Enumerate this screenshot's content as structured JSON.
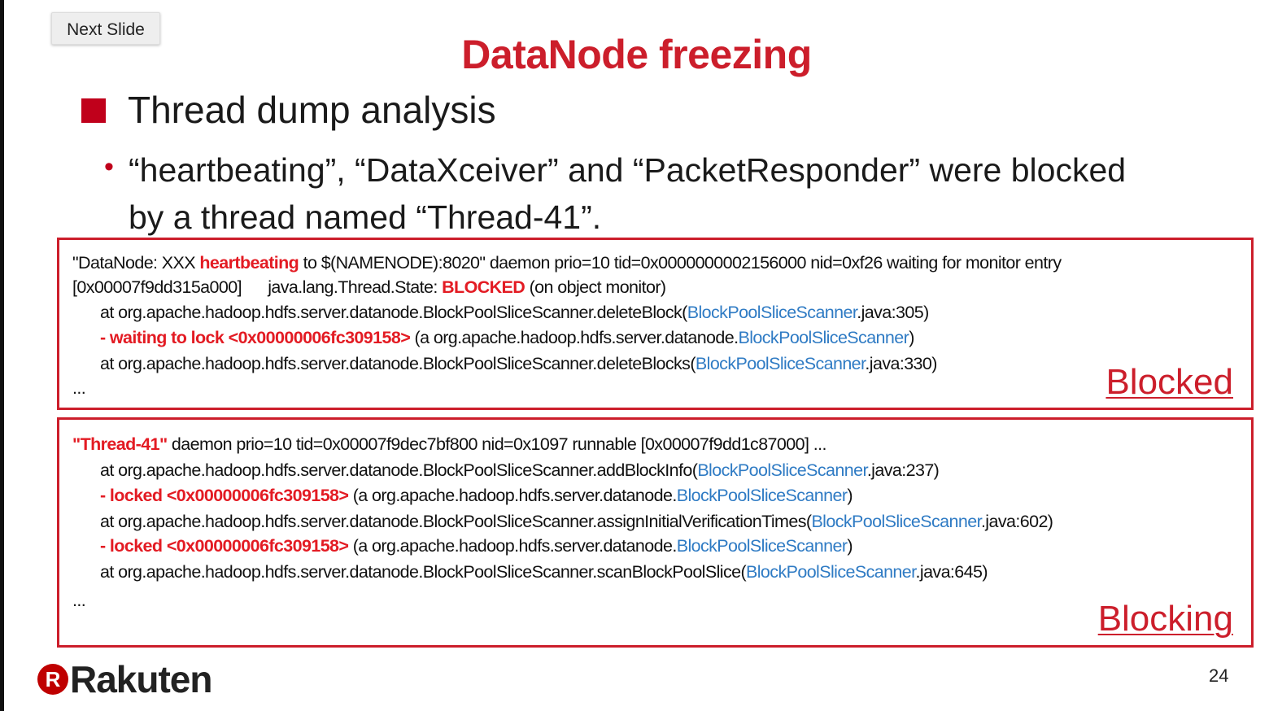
{
  "toolbar": {
    "next_slide_label": "Next Slide"
  },
  "slide": {
    "title": "DataNode freezing",
    "bullet": "Thread dump analysis",
    "sub_bullet": "“heartbeating”, “DataXceiver” and “PacketResponder” were blocked by a thread named “Thread-41”.",
    "page_number": "24",
    "logo_mark": "R",
    "logo_text": "Rakuten"
  },
  "box1": {
    "label": "Blocked",
    "line1": {
      "a": "\"DataNode: XXX ",
      "b": "heartbeating",
      "c": " to $(NAMENODE):8020\" daemon prio=10 tid=0x0000000002156000 nid=0xf26 waiting for monitor entry"
    },
    "line2": {
      "a": "[0x00007f9dd315a000]      java.lang.Thread.State: ",
      "b": "BLOCKED",
      "c": " (on object monitor)"
    },
    "line3": {
      "a": "at org.apache.hadoop.hdfs.server.datanode.BlockPoolSliceScanner.deleteBlock(",
      "b": "BlockPoolSliceScanner",
      "c": ".java:305)"
    },
    "line4": {
      "a": "- waiting to lock <0x00000006fc309158>",
      "b": " (a org.apache.hadoop.hdfs.server.datanode.",
      "c": "BlockPoolSliceScanner",
      "d": ")"
    },
    "line5": {
      "a": "at org.apache.hadoop.hdfs.server.datanode.BlockPoolSliceScanner.deleteBlocks(",
      "b": "BlockPoolSliceScanner",
      "c": ".java:330)"
    },
    "line6": "..."
  },
  "box2": {
    "label": "Blocking",
    "line1": {
      "a": "\"Thread-41\"",
      "b": " daemon prio=10 tid=0x00007f9dec7bf800 nid=0x1097 runnable [0x00007f9dd1c87000] ..."
    },
    "line2": {
      "a": "at org.apache.hadoop.hdfs.server.datanode.BlockPoolSliceScanner.addBlockInfo(",
      "b": "BlockPoolSliceScanner",
      "c": ".java:237)"
    },
    "line3": {
      "a": "- locked <0x00000006fc309158>",
      "b": " (a org.apache.hadoop.hdfs.server.datanode.",
      "c": "BlockPoolSliceScanner",
      "d": ")"
    },
    "line4": {
      "a": "at org.apache.hadoop.hdfs.server.datanode.BlockPoolSliceScanner.assignInitialVerificationTimes(",
      "b": "BlockPoolSliceScanner",
      "c": ".java:602)"
    },
    "line5": {
      "a": "- locked <0x00000006fc309158>",
      "b": " (a org.apache.hadoop.hdfs.server.datanode.",
      "c": "BlockPoolSliceScanner",
      "d": ")"
    },
    "line6": {
      "a": "at org.apache.hadoop.hdfs.server.datanode.BlockPoolSliceScanner.scanBlockPoolSlice(",
      "b": "BlockPoolSliceScanner",
      "c": ".java:645)"
    },
    "line7": "..."
  },
  "colors": {
    "title_red": "#cc1e2b",
    "highlight_red": "#e31b23",
    "link_blue": "#2f7bc4",
    "bullet_red": "#c0001b"
  }
}
